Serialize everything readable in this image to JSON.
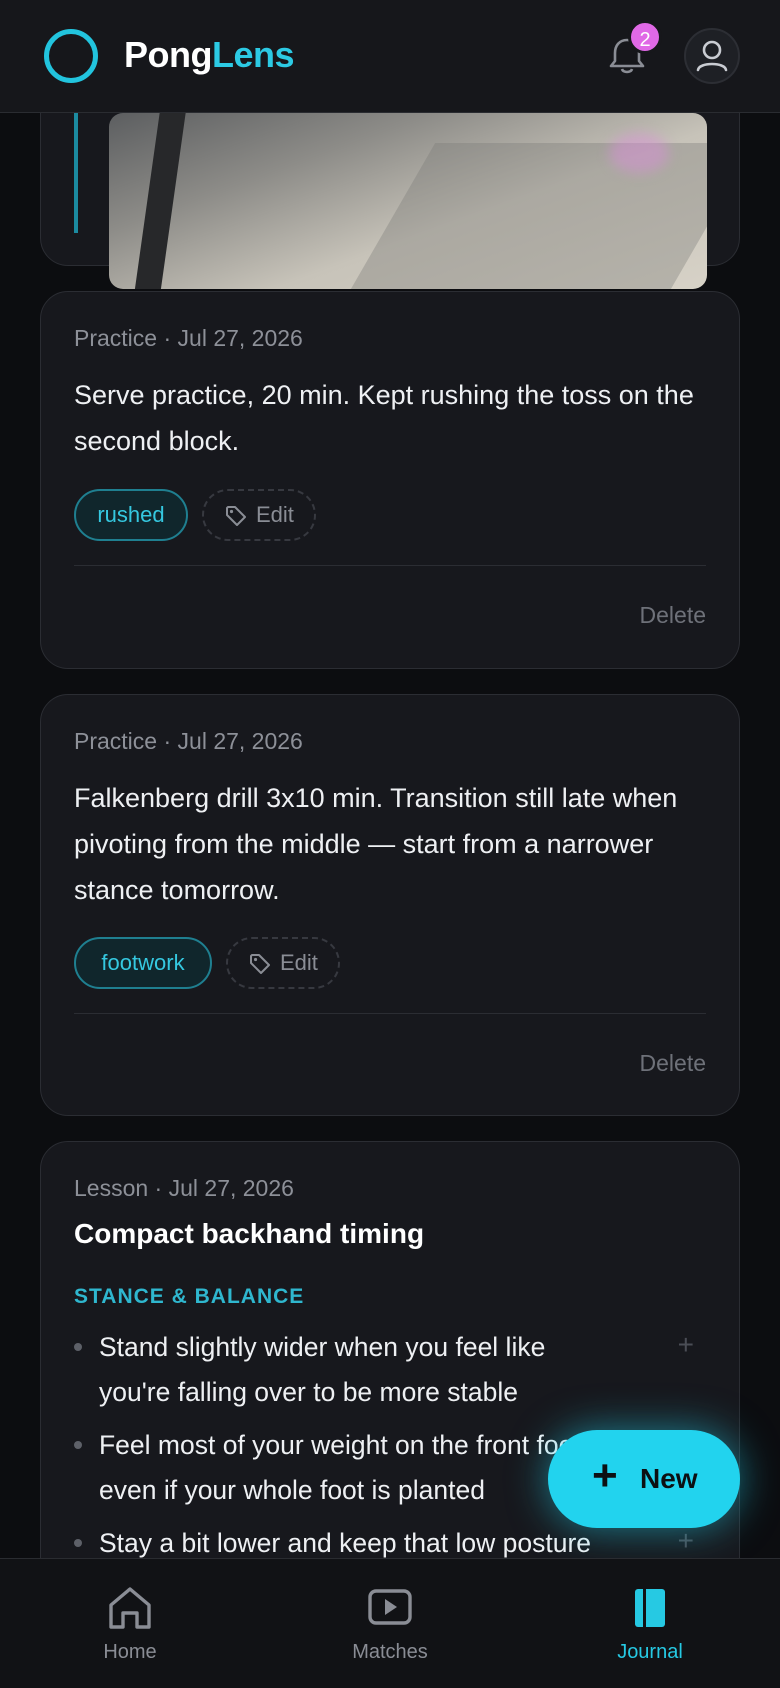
{
  "header": {
    "brand_part1": "Pong",
    "brand_part2": "Lens",
    "notification_count": "2",
    "accent_color": "#22d3ee"
  },
  "entries": [
    {
      "meta": "Practice · Jul 27, 2026",
      "text": "Serve practice, 20 min. Kept rushing the toss on the second block.",
      "tag": "rushed",
      "edit_label": "Edit",
      "delete_label": "Delete"
    },
    {
      "meta": "Practice · Jul 27, 2026",
      "text": "Falkenberg drill 3x10 min. Transition still late when pivoting from the middle — start from a narrower stance tomorrow.",
      "tag": "footwork",
      "edit_label": "Edit",
      "delete_label": "Delete"
    }
  ],
  "lesson": {
    "meta": "Lesson · Jul 27, 2026",
    "title": "Compact backhand timing",
    "section": "STANCE & BALANCE",
    "items": [
      "Stand slightly wider when you feel like you're falling over to be more stable",
      "Feel most of your weight on the front foot even if your whole foot is planted",
      "Stay a bit lower and keep that low posture"
    ]
  },
  "fab": {
    "label": "New"
  },
  "nav": {
    "items": [
      {
        "label": "Home",
        "icon": "home-icon"
      },
      {
        "label": "Matches",
        "icon": "play-icon"
      },
      {
        "label": "Journal",
        "icon": "journal-icon"
      }
    ],
    "active": "Journal"
  }
}
